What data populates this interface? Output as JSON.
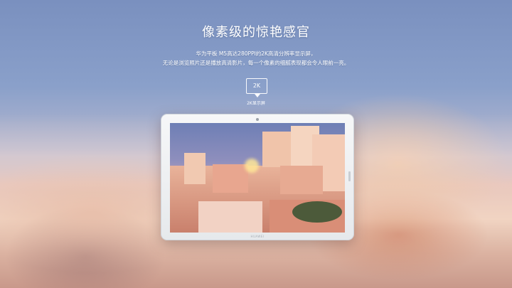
{
  "headline": "像素级的惊艳感官",
  "description": {
    "line1": "华为平板 M5高达280PPI的2K高清分辨率显示屏，",
    "line2": "无论是浏览照片还是播放高清影片，每一个像素的细腻表现都会令人眼前一亮。"
  },
  "badge": {
    "label": "2K",
    "caption": "2K显示屏"
  },
  "tablet": {
    "brand": "HUAWEI"
  },
  "colors": {
    "text": "#ffffff",
    "sky_top": "#7b90bd",
    "sunset": "#f0d4c3"
  }
}
